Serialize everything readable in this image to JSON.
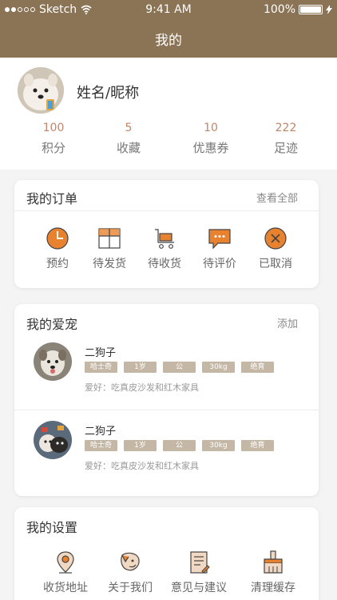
{
  "status_bar": {
    "carrier": "Sketch",
    "time": "9:41 AM",
    "battery": "100%",
    "battery_level": 1.0
  },
  "nav": {
    "title": "我的"
  },
  "profile": {
    "name": "姓名/昵称"
  },
  "stats": [
    {
      "value": "100",
      "label": "积分"
    },
    {
      "value": "5",
      "label": "收藏"
    },
    {
      "value": "10",
      "label": "优惠券"
    },
    {
      "value": "222",
      "label": "足迹"
    }
  ],
  "orders": {
    "title": "我的订单",
    "view_all": "查看全部",
    "items": [
      {
        "label": "预约",
        "icon": "clock-icon"
      },
      {
        "label": "待发货",
        "icon": "box-icon"
      },
      {
        "label": "待收货",
        "icon": "cart-icon"
      },
      {
        "label": "待评价",
        "icon": "comment-icon"
      },
      {
        "label": "已取消",
        "icon": "cancel-icon"
      }
    ]
  },
  "pets": {
    "title": "我的爱宠",
    "add": "添加",
    "items": [
      {
        "name": "二狗子",
        "tags": [
          "哈士奇",
          "1岁",
          "公",
          "30kg",
          "绝育"
        ],
        "hobby": "爱好：吃真皮沙发和红木家具"
      },
      {
        "name": "二狗子",
        "tags": [
          "哈士奇",
          "1岁",
          "公",
          "30kg",
          "绝育"
        ],
        "hobby": "爱好：吃真皮沙发和红木家具"
      }
    ]
  },
  "settings": {
    "title": "我的设置",
    "items": [
      {
        "label": "收货地址",
        "icon": "location-icon"
      },
      {
        "label": "关于我们",
        "icon": "pet-head-icon"
      },
      {
        "label": "意见与建议",
        "icon": "feedback-icon"
      },
      {
        "label": "清理缓存",
        "icon": "broom-icon"
      }
    ]
  },
  "colors": {
    "header": "#8b7355",
    "accent": "#e8822f",
    "stat_value": "#c0866a",
    "tag": "#c4b7a6"
  }
}
